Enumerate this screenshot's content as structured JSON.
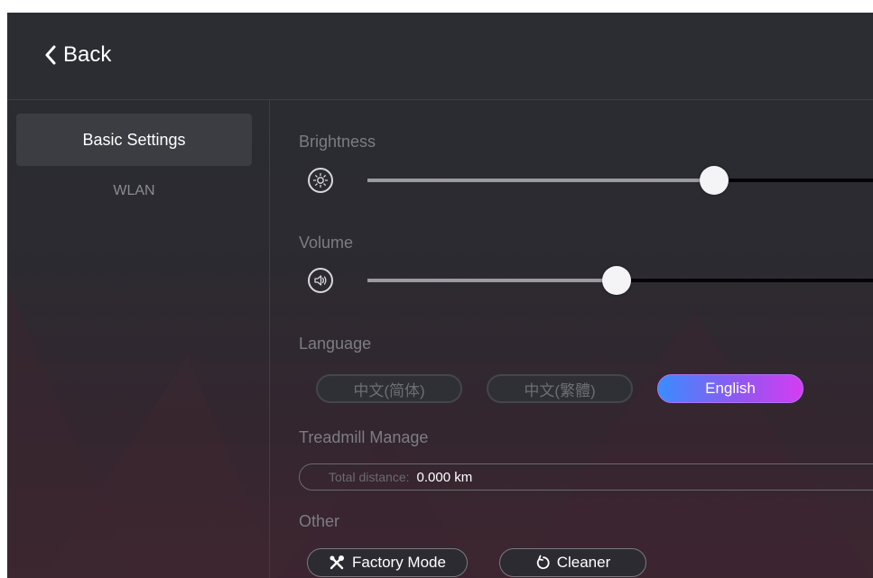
{
  "header": {
    "back_label": "Back",
    "back_icon": "chevron-left-icon"
  },
  "sidebar": {
    "items": [
      {
        "label": "Basic Settings",
        "selected": true
      },
      {
        "label": "WLAN",
        "selected": false
      }
    ]
  },
  "brightness": {
    "label": "Brightness",
    "icon": "brightness-icon",
    "level": 0.64
  },
  "volume": {
    "label": "Volume",
    "icon": "volume-icon",
    "level": 0.46
  },
  "language": {
    "label": "Language",
    "options": [
      {
        "label": "中文(简体)",
        "selected": false
      },
      {
        "label": "中文(繁體)",
        "selected": false
      },
      {
        "label": "English",
        "selected": true
      }
    ]
  },
  "treadmill": {
    "label": "Treadmill Manage",
    "distance_label": "Total distance:",
    "distance_value": "0.000 km"
  },
  "other": {
    "label": "Other",
    "factory_label": "Factory Mode",
    "factory_icon": "wrench-icon",
    "cleaner_label": "Cleaner",
    "cleaner_icon": "refresh-icon"
  },
  "colors": {
    "accent_gradient_start": "#3a8dff",
    "accent_gradient_end": "#d43df2",
    "background": "#2b2d32"
  }
}
